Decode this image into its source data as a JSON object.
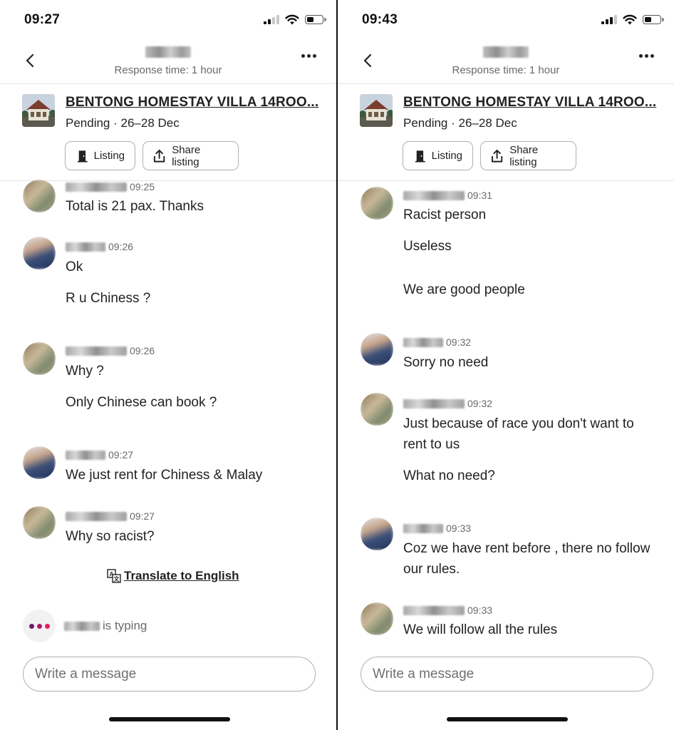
{
  "colors": {
    "accent_dot_1": "#6a1b6a",
    "accent_dot_2": "#b0186f",
    "accent_dot_3": "#e0245e",
    "text_primary": "#222222",
    "text_secondary": "#6a6a6a",
    "border": "#b0b0b0"
  },
  "screens": [
    {
      "status": {
        "time": "09:27"
      },
      "header": {
        "response_time": "Response time: 1 hour",
        "back_icon": "chevron-left-icon",
        "more_icon": "ellipsis-icon"
      },
      "listing": {
        "title": "BENTONG HOMESTAY VILLA 14ROO...",
        "status": "Pending · 26–28 Dec",
        "listing_button": "Listing",
        "share_button": "Share listing"
      },
      "messages": [
        {
          "time": "09:25",
          "text": [
            "Total is 21 pax. Thanks"
          ]
        },
        {
          "time": "09:26",
          "text": [
            "Ok",
            "R u Chiness ?"
          ]
        },
        {
          "time": "09:26",
          "text": [
            "Why ?",
            "Only Chinese can book ?"
          ]
        },
        {
          "time": "09:27",
          "text": [
            "We just rent for Chiness & Malay"
          ]
        },
        {
          "time": "09:27",
          "text": [
            "Why so racist?"
          ]
        }
      ],
      "translate": {
        "label": "Translate to English"
      },
      "typing": {
        "label": "is typing"
      },
      "composer": {
        "placeholder": "Write a message"
      }
    },
    {
      "status": {
        "time": "09:43"
      },
      "header": {
        "response_time": "Response time: 1 hour",
        "back_icon": "chevron-left-icon",
        "more_icon": "ellipsis-icon"
      },
      "listing": {
        "title": "BENTONG HOMESTAY VILLA 14ROO...",
        "status": "Pending · 26–28 Dec",
        "listing_button": "Listing",
        "share_button": "Share listing"
      },
      "messages": [
        {
          "time": "09:31",
          "text": [
            "Racist person",
            "Useless",
            "We are good people"
          ]
        },
        {
          "time": "09:32",
          "text": [
            "Sorry no need"
          ]
        },
        {
          "time": "09:32",
          "text": [
            "Just because of race you don't want to rent to us",
            "What no need?"
          ]
        },
        {
          "time": "09:33",
          "text": [
            "Coz we have rent before , there no follow our rules."
          ]
        },
        {
          "time": "09:33",
          "text": [
            "We will follow all the rules"
          ]
        }
      ],
      "composer": {
        "placeholder": "Write a message"
      }
    }
  ]
}
